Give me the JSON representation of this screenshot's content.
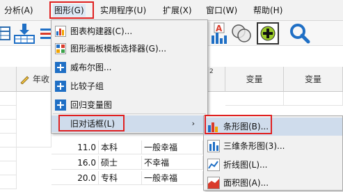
{
  "menubar": {
    "items": [
      {
        "label": "分析(A)"
      },
      {
        "label": "图形(G)"
      },
      {
        "label": "实用程序(U)"
      },
      {
        "label": "扩展(X)"
      },
      {
        "label": "窗口(W)"
      },
      {
        "label": "帮助(H)"
      }
    ]
  },
  "toolbar": {
    "icons": [
      "table-icon",
      "import-icon",
      "list-icon",
      "chart-a-icon",
      "venn-icon",
      "add-icon",
      "search-icon"
    ]
  },
  "grid": {
    "headers": [
      "年收",
      "变量",
      "变量"
    ],
    "header_fragment": "2",
    "rows": [
      {
        "num": "11.0",
        "edu": "本科",
        "status": "一般幸福"
      },
      {
        "num": "16.0",
        "edu": "硕士",
        "status": "不幸福"
      },
      {
        "num": "20.0",
        "edu": "专科",
        "status": "一般幸福"
      },
      {
        "num": "",
        "edu": "",
        "status": ""
      }
    ]
  },
  "graphs_menu": {
    "items": [
      {
        "label": "图表构建器(C)...",
        "icon": "chart-builder-icon"
      },
      {
        "label": "图形画板模板选择器(G)...",
        "icon": "graphboard-icon"
      },
      {
        "label": "威布尔图...",
        "icon": "plus-box-icon"
      },
      {
        "label": "比较子组",
        "icon": "plus-box-icon"
      },
      {
        "label": "回归变量图",
        "icon": "plus-box-icon"
      },
      {
        "label": "旧对话框(L)",
        "icon": "",
        "submenu_arrow": "›"
      }
    ]
  },
  "legacy_submenu": {
    "items": [
      {
        "label": "条形图(B)...",
        "icon": "bar-chart-icon"
      },
      {
        "label": "三维条形图(3)...",
        "icon": "3d-bar-chart-icon"
      },
      {
        "label": "折线图(L)...",
        "icon": "line-chart-icon"
      },
      {
        "label": "面积图(A)...",
        "icon": "area-chart-icon"
      }
    ]
  },
  "colors": {
    "highlight_box": "#e02020",
    "menu_highlight": "#cfdcec",
    "accent_blue": "#1f6fc5"
  }
}
